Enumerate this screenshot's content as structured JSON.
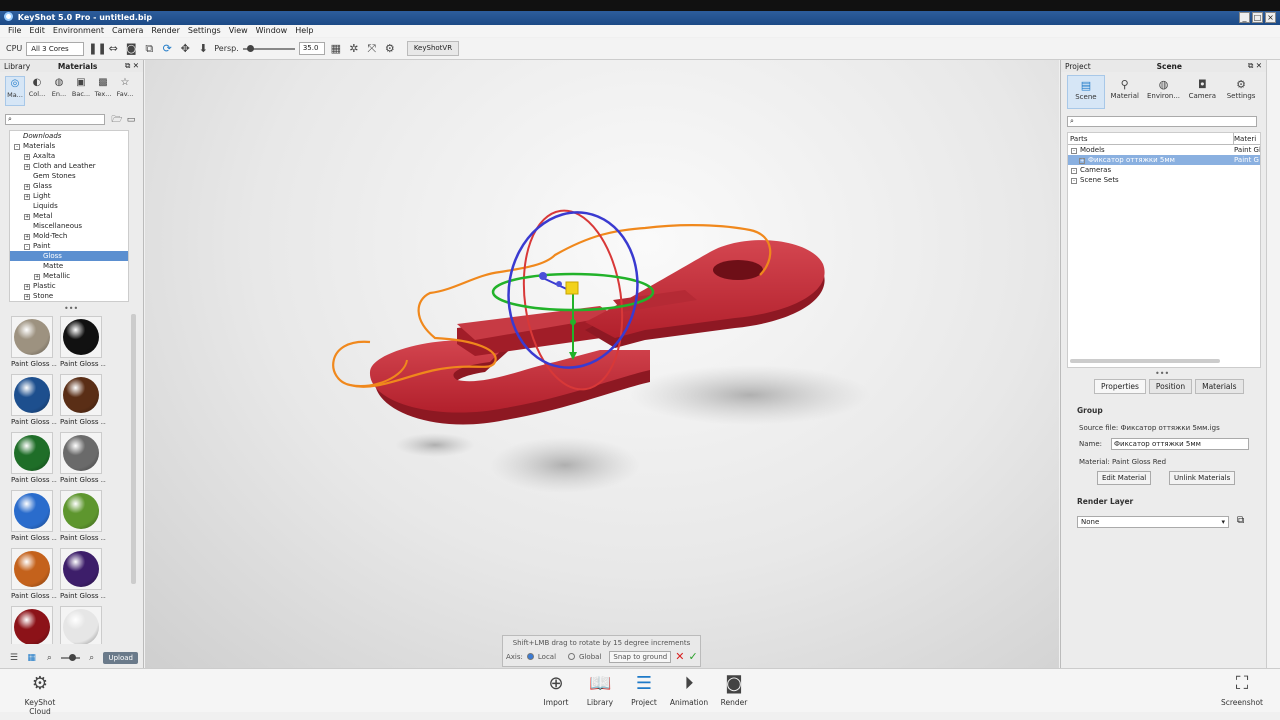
{
  "window": {
    "title": "KeyShot 5.0 Pro  - untitled.bip"
  },
  "menu": [
    "File",
    "Edit",
    "Environment",
    "Camera",
    "Render",
    "Settings",
    "View",
    "Window",
    "Help"
  ],
  "toolbar": {
    "cpu_label": "CPU",
    "cores": "All 3 Cores",
    "persp_label": "Persp.",
    "fov": "35.0",
    "vr_label": "KeyShotVR"
  },
  "library": {
    "header": "Library",
    "title": "Materials",
    "tabs": [
      "Ma...",
      "Col...",
      "En...",
      "Bac...",
      "Tex...",
      "Fav..."
    ],
    "tree": [
      {
        "label": "Downloads",
        "exp": "",
        "indent": 0,
        "italic": true
      },
      {
        "label": "Materials",
        "exp": "-",
        "indent": 0
      },
      {
        "label": "Axalta",
        "exp": "+",
        "indent": 1
      },
      {
        "label": "Cloth and Leather",
        "exp": "+",
        "indent": 1
      },
      {
        "label": "Gem Stones",
        "exp": "",
        "indent": 1
      },
      {
        "label": "Glass",
        "exp": "+",
        "indent": 1
      },
      {
        "label": "Light",
        "exp": "+",
        "indent": 1
      },
      {
        "label": "Liquids",
        "exp": "",
        "indent": 1
      },
      {
        "label": "Metal",
        "exp": "+",
        "indent": 1
      },
      {
        "label": "Miscellaneous",
        "exp": "",
        "indent": 1
      },
      {
        "label": "Mold-Tech",
        "exp": "+",
        "indent": 1
      },
      {
        "label": "Paint",
        "exp": "-",
        "indent": 1
      },
      {
        "label": "Gloss",
        "exp": "",
        "indent": 2,
        "selected": true
      },
      {
        "label": "Matte",
        "exp": "",
        "indent": 2
      },
      {
        "label": "Metallic",
        "exp": "+",
        "indent": 2
      },
      {
        "label": "Plastic",
        "exp": "+",
        "indent": 1
      },
      {
        "label": "Stone",
        "exp": "+",
        "indent": 1
      }
    ],
    "swatches": [
      {
        "label": "Paint Gloss ...",
        "color": "#9d9280"
      },
      {
        "label": "Paint Gloss ...",
        "color": "#111111"
      },
      {
        "label": "Paint Gloss ...",
        "color": "#1d4f8e"
      },
      {
        "label": "Paint Gloss ...",
        "color": "#5a2e16"
      },
      {
        "label": "Paint Gloss ...",
        "color": "#1f6e28"
      },
      {
        "label": "Paint Gloss ...",
        "color": "#6a6a6a"
      },
      {
        "label": "Paint Gloss ...",
        "color": "#2a6ccc"
      },
      {
        "label": "Paint Gloss ...",
        "color": "#5e962e"
      },
      {
        "label": "Paint Gloss ...",
        "color": "#c4621c"
      },
      {
        "label": "Paint Gloss ...",
        "color": "#3d1e6a"
      },
      {
        "label": "Paint Gloss ...",
        "color": "#8c1218"
      },
      {
        "label": "Paint Gloss ...",
        "color": "#e6e6e6"
      }
    ],
    "upload": "Upload"
  },
  "hud": {
    "hint": "Shift+LMB drag to rotate by 15 degree increments",
    "axis": "Axis:",
    "local": "Local",
    "global": "Global",
    "snap": "Snap to ground"
  },
  "project": {
    "header": "Project",
    "title": "Scene",
    "tabs": [
      "Scene",
      "Material",
      "Environ...",
      "Camera",
      "Settings"
    ],
    "col_parts": "Parts",
    "col_material": "Materi",
    "rows": [
      {
        "label": "Models",
        "mat": "Paint Gl",
        "indent": 0
      },
      {
        "label": "Фиксатор оттяжки 5мм",
        "mat": "Paint G",
        "indent": 1,
        "selected": true
      },
      {
        "label": "Cameras",
        "mat": "",
        "indent": 0
      },
      {
        "label": "Scene Sets",
        "mat": "",
        "indent": 0
      }
    ],
    "prop_tabs": [
      "Properties",
      "Position",
      "Materials"
    ],
    "group": "Group",
    "source": "Source file: Фиксатор оттяжки 5мм.igs",
    "name_label": "Name:",
    "name_value": "Фиксатор оттяжки 5мм",
    "material": "Material:  Paint Gloss Red",
    "edit_material": "Edit Material",
    "unlink_materials": "Unlink Materials",
    "render_layer": "Render Layer",
    "render_layer_value": "None"
  },
  "bottom": {
    "cloud": "KeyShot Cloud",
    "buttons": [
      "Import",
      "Library",
      "Project",
      "Animation",
      "Render"
    ],
    "screenshot": "Screenshot"
  }
}
